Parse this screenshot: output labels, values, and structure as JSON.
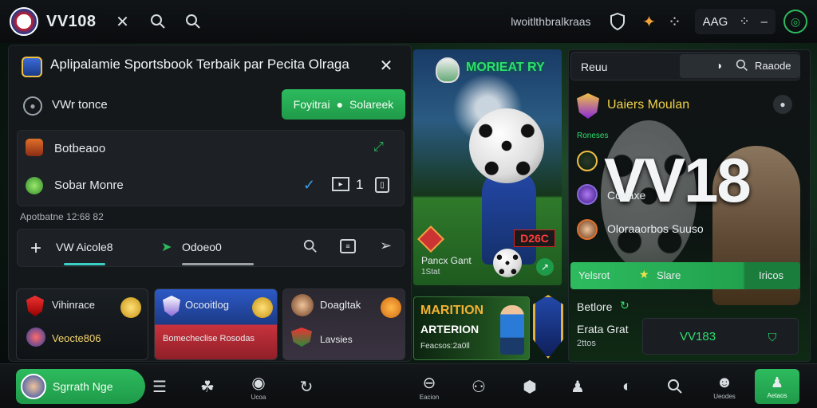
{
  "topbar": {
    "brand": "VV108",
    "right_text": "lwoitlthbralkraas",
    "pill_text": "AAG"
  },
  "promo": {
    "title": "Aplipalamie Sportsbook Terbaik par Pecita Olraga",
    "username": "VWr tonce",
    "register_label": "Foyitrai",
    "login_label": "Solareek"
  },
  "list": {
    "item1": "Botbeaoo",
    "item2": "Sobar Monre",
    "count": "1",
    "timestamp": "Apotbatne 12:68 82"
  },
  "tabs": {
    "tab1": "VW Aicole8",
    "tab2": "Odoeo0",
    "add_symbol": "+"
  },
  "cards": [
    {
      "title": "Vihinrace",
      "sub": "Veocte806"
    },
    {
      "title": "Ocooitlog",
      "sub": "Bomecheclise Rosodas"
    },
    {
      "title": "Doagltak",
      "sub": "Lavsies"
    }
  ],
  "hero": {
    "label": "MORIEAT RY",
    "tag": "D26C",
    "caption_title": "Pancx Gant",
    "caption_sub": "1Stat"
  },
  "banner": {
    "line1": "MARITION",
    "line2": "ARTERION",
    "line3": "Feacsos:2a0ll"
  },
  "right": {
    "search_label": "Reuu",
    "search_right": "Raaode",
    "team_title": "Uaiers Moulan",
    "section_label": "Roneses",
    "big_number": "VV18",
    "item1": "Conaxe",
    "item2": "Oloraaorbos Suuso",
    "green_left": "Yelsrot",
    "green_mid": "Slare",
    "green_right": "Iricos",
    "stat1": "Betlore",
    "stat2": "Erata Grat",
    "stat3": "2ttos",
    "box_value": "VV183"
  },
  "bottombar": {
    "pill_label": "Sgrrath Nge",
    "labels": [
      "Ucoa",
      "Eacion",
      "Ueodes",
      "Aetaos"
    ]
  },
  "colors": {
    "accent_green": "#22b14c",
    "brand_red": "#c81d2a",
    "brand_blue": "#1c3b8f",
    "panel": "#15181b"
  }
}
